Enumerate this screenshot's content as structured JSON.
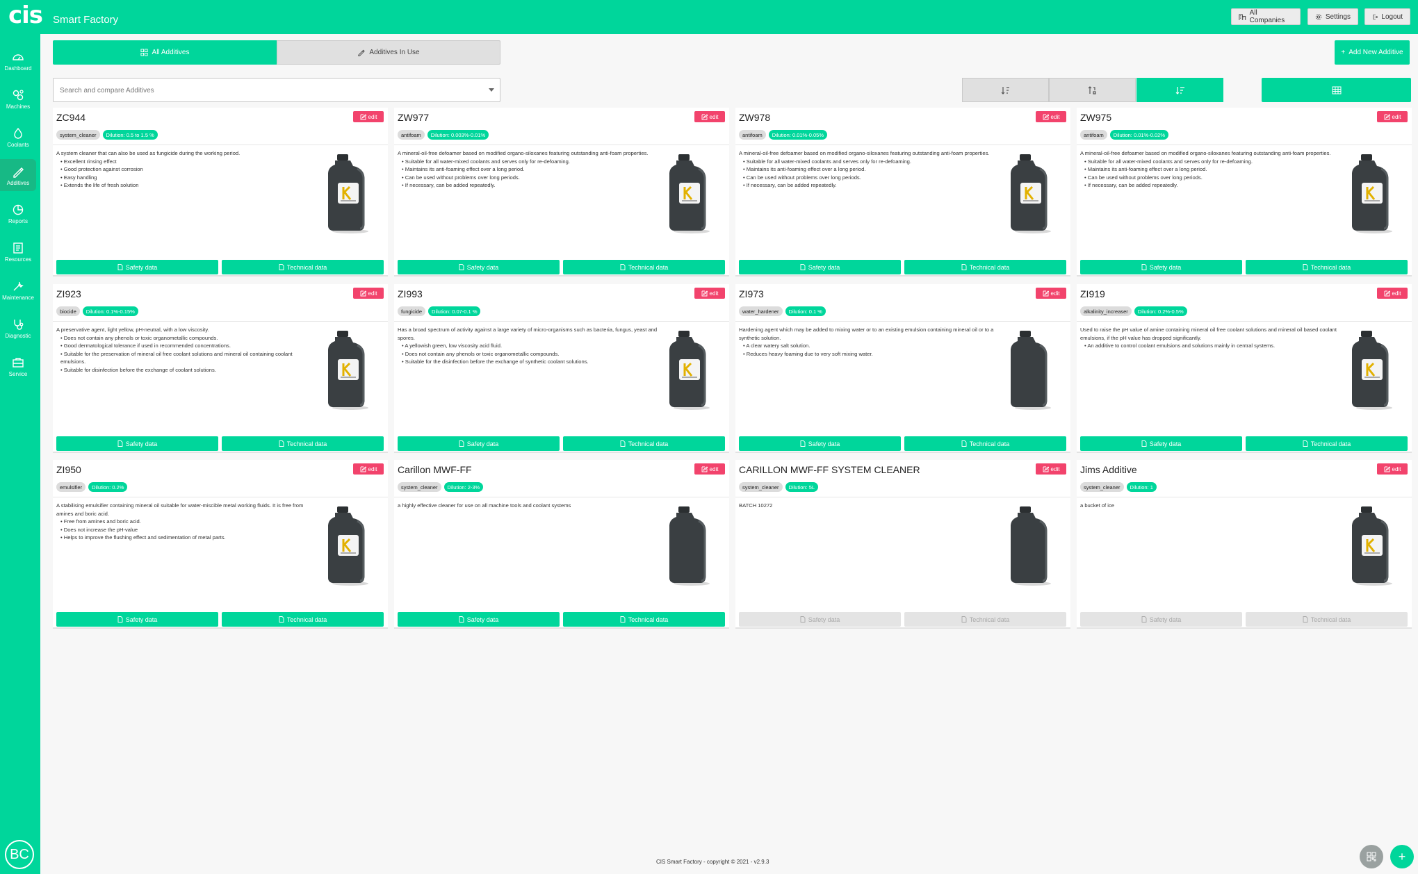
{
  "header": {
    "logo": "cis",
    "app_title": "Smart Factory",
    "buttons": {
      "companies": "All Companies",
      "settings": "Settings",
      "logout": "Logout"
    }
  },
  "sidebar": {
    "items": [
      {
        "label": "Dashboard",
        "icon": "dashboard-icon"
      },
      {
        "label": "Machines",
        "icon": "machines-icon"
      },
      {
        "label": "Coolants",
        "icon": "coolants-icon"
      },
      {
        "label": "Additives",
        "icon": "additives-icon",
        "active": true
      },
      {
        "label": "Reports",
        "icon": "reports-icon"
      },
      {
        "label": "Resources",
        "icon": "resources-icon"
      },
      {
        "label": "Maintenance",
        "icon": "maintenance-icon"
      },
      {
        "label": "Diagnostic",
        "icon": "diagnostic-icon"
      },
      {
        "label": "Service",
        "icon": "service-icon"
      }
    ],
    "avatar": "BC"
  },
  "tabs": {
    "all": "All Additives",
    "in_use": "Additives In Use"
  },
  "add_button": "Add New Additive",
  "search": {
    "placeholder": "Search and compare Additives"
  },
  "sort_buttons": [
    {
      "icon": "sort-alpha-icon",
      "active": false
    },
    {
      "icon": "sort-numeric-icon",
      "active": false
    },
    {
      "icon": "sort-amount-icon",
      "active": true
    }
  ],
  "view_toggle_icon": "grid-view-icon",
  "labels": {
    "edit": "edit",
    "safety": "Safety data",
    "technical": "Technical data"
  },
  "cards": [
    {
      "name": "ZC944",
      "type": "system_cleaner",
      "dilution": "Dilution: 0.5 to 1.5 %",
      "logo": true,
      "docs": true,
      "intro": "A system cleaner that can also be used as fungicide during the working period.",
      "bullets": [
        "Excellent rinsing effect",
        "Good protection against corrosion",
        "Easy handling",
        "Extends the life of fresh solution"
      ]
    },
    {
      "name": "ZW977",
      "type": "antifoam",
      "dilution": "Dilution: 0.003%-0.01%",
      "logo": true,
      "docs": true,
      "intro": "A mineral-oil-free defoamer based on modified organo-siloxanes featuring outstanding anti-foam properties.",
      "bullets": [
        "Suitable for all water-mixed coolants and serves only for re-defoaming.",
        "Maintains its anti-foaming effect over a long period.",
        "Can be used without problems over long periods.",
        "If necessary, can be added repeatedly."
      ]
    },
    {
      "name": "ZW978",
      "type": "antifoam",
      "dilution": "Dilution: 0.01%-0.05%",
      "logo": true,
      "docs": true,
      "intro": "A mineral-oil-free defoamer based on modified organo-siloxanes featuring outstanding anti-foam properties.",
      "bullets": [
        "Suitable for all water-mixed coolants and serves only for re-defoaming.",
        "Maintains its anti-foaming effect over a long period.",
        "Can be used without problems over long periods.",
        "If necessary, can be added repeatedly."
      ]
    },
    {
      "name": "ZW975",
      "type": "antifoam",
      "dilution": "Dilution: 0.01%-0.02%",
      "logo": true,
      "docs": true,
      "intro": "A mineral-oil-free defoamer based on modified organo-siloxanes featuring outstanding anti-foam properties.",
      "bullets": [
        "Suitable for all water-mixed coolants and serves only for re-defoaming.",
        "Maintains its anti-foaming effect over a long period.",
        "Can be used without problems over long periods.",
        "If necessary, can be added repeatedly."
      ]
    },
    {
      "name": "ZI923",
      "type": "biocide",
      "dilution": "Dilution: 0.1%-0.15%",
      "logo": true,
      "docs": true,
      "intro": "A preservative agent, light yellow, pH-neutral, with a low viscosity.",
      "bullets": [
        "Does not contain any phenols or toxic organometallic compounds.",
        "Good dermatological tolerance if used in recommended concentrations.",
        "Suitable for the preservation of mineral oil free coolant solutions and mineral oil containing coolant emulsions.",
        "Suitable for disinfection before the exchange of coolant solutions."
      ]
    },
    {
      "name": "ZI993",
      "type": "fungicide",
      "dilution": "Dilution: 0.07-0.1 %",
      "logo": true,
      "docs": true,
      "intro": "Has a broad spectrum of activity against a large variety of micro-organisms such as bacteria, fungus, yeast and spores.",
      "bullets": [
        "A yellowish green, low viscosity acid fluid.",
        "Does not contain any phenols or toxic organometallic compounds.",
        "Suitable for the disinfection before the exchange of synthetic coolant solutions."
      ]
    },
    {
      "name": "ZI973",
      "type": "water_hardener",
      "dilution": "Dilution: 0.1 %",
      "logo": false,
      "docs": true,
      "intro": "Hardening agent which may be added to mixing water or to an existing emulsion containing mineral oil or to a synthetic solution.",
      "bullets": [
        "A clear watery salt solution.",
        "Reduces heavy foaming due to very soft mixing water."
      ]
    },
    {
      "name": "ZI919",
      "type": "alkalinity_increaser",
      "dilution": "Dilution: 0.2%-0.5%",
      "logo": true,
      "docs": true,
      "intro": "Used to raise the pH value of amine containing mineral oil free coolant solutions and mineral oil based coolant emulsions, if the pH value has dropped significantly.",
      "bullets": [
        "An additive to control coolant emulsions and solutions mainly in central systems."
      ]
    },
    {
      "name": "ZI950",
      "type": "emulsifier",
      "dilution": "Dilution: 0.2%",
      "logo": true,
      "docs": true,
      "intro": "A stabilising emulsifier containing mineral oil suitable for water-miscible metal working fluids. It is free from amines and boric acid.",
      "bullets": [
        "Free from amines and boric acid.",
        "Does not increase the pH-value",
        "Helps to improve the flushing effect and sedimentation of metal parts."
      ]
    },
    {
      "name": "Carillon MWF-FF",
      "type": "system_cleaner",
      "dilution": "Dilution: 2-3%",
      "logo": false,
      "docs": true,
      "intro": "a highly effective cleaner for use on all machine tools and coolant systems",
      "bullets": []
    },
    {
      "name": "CARILLON MWF-FF SYSTEM CLEANER",
      "type": "system_cleaner",
      "dilution": "Dilution: 5L",
      "logo": false,
      "docs": false,
      "intro": "BATCH 10272",
      "bullets": []
    },
    {
      "name": "Jims Additive",
      "type": "system_cleaner",
      "dilution": "Dilution: 1",
      "logo": true,
      "docs": false,
      "intro": "a bucket of ice",
      "bullets": []
    }
  ],
  "footer": "CIS Smart Factory - copyright © 2021 - v2.9.3",
  "colors": {
    "brand": "#00d69b",
    "edit": "#f2436c",
    "bottle": "#3a3f42"
  }
}
